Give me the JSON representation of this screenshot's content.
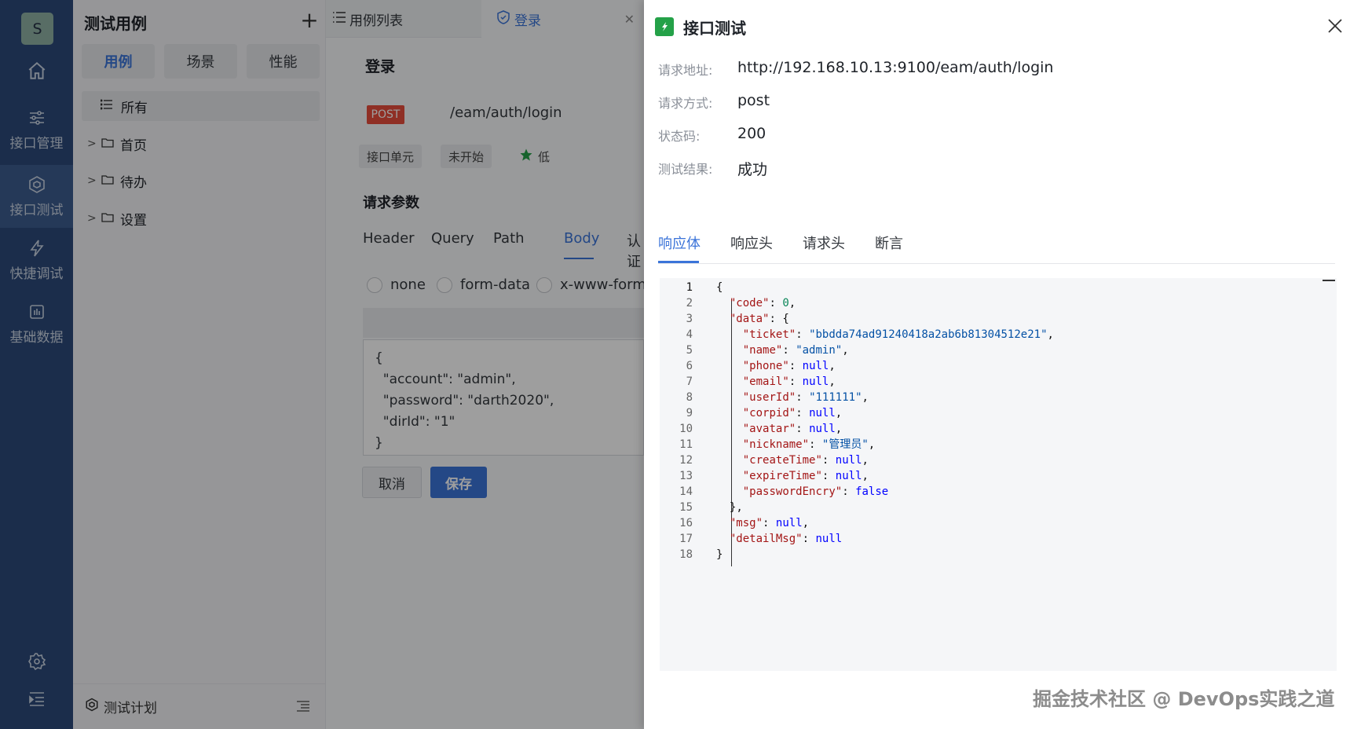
{
  "nav": {
    "avatar": "S",
    "items": [
      {
        "label": "",
        "icon": "home-icon"
      },
      {
        "label": "接口管理",
        "icon": "sliders-icon"
      },
      {
        "label": "接口测试",
        "icon": "cube-icon"
      },
      {
        "label": "快捷调试",
        "icon": "lightning-icon"
      },
      {
        "label": "基础数据",
        "icon": "chart-box-icon"
      }
    ],
    "active": "接口测试",
    "bottom_icons": [
      "gear-icon",
      "menu-indent-icon"
    ]
  },
  "case_panel": {
    "title": "测试用例",
    "segments": [
      "用例",
      "场景",
      "性能"
    ],
    "active_segment": "用例",
    "tree_all": "所有",
    "tree": [
      "首页",
      "待办",
      "设置"
    ],
    "footer": "测试计划"
  },
  "main": {
    "tabs": {
      "list": "用例列表",
      "active": "登录"
    },
    "api_title": "登录",
    "method": "POST",
    "path": "/eam/auth/login",
    "tags": {
      "type": "接口单元",
      "status": "未开始",
      "priority": "低"
    },
    "section": "请求参数",
    "param_tabs": [
      "Header",
      "Query",
      "Path",
      "Body",
      "认证"
    ],
    "active_param_tab": "Body",
    "body_types": [
      "none",
      "form-data",
      "x-www-form-"
    ],
    "body_text": "{\n  \"account\": \"admin\",\n  \"password\": \"darth2020\",\n  \"dirId\": \"1\"\n}",
    "cancel": "取消",
    "save": "保存"
  },
  "drawer": {
    "title": "接口测试",
    "info": [
      {
        "label": "请求地址:",
        "value": "http://192.168.10.13:9100/eam/auth/login"
      },
      {
        "label": "请求方式:",
        "value": "post"
      },
      {
        "label": "状态码:",
        "value": "200"
      },
      {
        "label": "测试结果:",
        "value": "成功"
      }
    ],
    "tabs": [
      "响应体",
      "响应头",
      "请求头",
      "断言"
    ],
    "active_tab": "响应体",
    "code_lines": [
      "{",
      "  \"code\": 0,",
      "  \"data\": {",
      "    \"ticket\": \"bbdda74ad91240418a2ab6b81304512e21\",",
      "    \"name\": \"admin\",",
      "    \"phone\": null,",
      "    \"email\": null,",
      "    \"userId\": \"111111\",",
      "    \"corpid\": null,",
      "    \"avatar\": null,",
      "    \"nickname\": \"管理员\",",
      "    \"createTime\": null,",
      "    \"expireTime\": null,",
      "    \"passwordEncry\": false",
      "  },",
      "  \"msg\": null,",
      "  \"detailMsg\": null",
      "}"
    ]
  },
  "watermark": "掘金技术社区 @ DevOps实践之道",
  "colors": {
    "nav_bg": "#2d4a7a",
    "accent": "#3b74d9",
    "post_badge": "#e74c3c",
    "success_green": "#24a148"
  }
}
